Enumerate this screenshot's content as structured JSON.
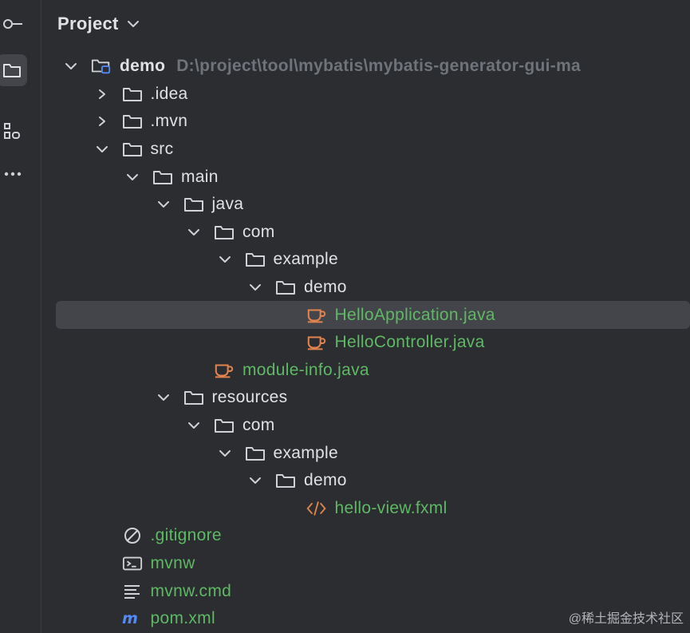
{
  "header": {
    "title": "Project"
  },
  "tree": [
    {
      "level": 0,
      "expanded": true,
      "type": "module",
      "label": "demo",
      "hint": "D:\\project\\tool\\mybatis\\mybatis-generator-gui-ma",
      "color": "plain",
      "bold": true
    },
    {
      "level": 1,
      "expanded": false,
      "type": "folder",
      "label": ".idea",
      "color": "plain"
    },
    {
      "level": 1,
      "expanded": false,
      "type": "folder",
      "label": ".mvn",
      "color": "plain"
    },
    {
      "level": 1,
      "expanded": true,
      "type": "folder",
      "label": "src",
      "color": "plain"
    },
    {
      "level": 2,
      "expanded": true,
      "type": "folder",
      "label": "main",
      "color": "plain"
    },
    {
      "level": 3,
      "expanded": true,
      "type": "folder",
      "label": "java",
      "color": "plain"
    },
    {
      "level": 4,
      "expanded": true,
      "type": "folder",
      "label": "com",
      "color": "plain"
    },
    {
      "level": 5,
      "expanded": true,
      "type": "folder",
      "label": "example",
      "color": "plain"
    },
    {
      "level": 6,
      "expanded": true,
      "type": "folder",
      "label": "demo",
      "color": "plain"
    },
    {
      "level": 7,
      "type": "java",
      "label": "HelloApplication.java",
      "color": "green",
      "selected": true
    },
    {
      "level": 7,
      "type": "java",
      "label": "HelloController.java",
      "color": "green"
    },
    {
      "level": 4,
      "type": "java",
      "label": "module-info.java",
      "color": "green"
    },
    {
      "level": 3,
      "expanded": true,
      "type": "folder",
      "label": "resources",
      "color": "plain"
    },
    {
      "level": 4,
      "expanded": true,
      "type": "folder",
      "label": "com",
      "color": "plain"
    },
    {
      "level": 5,
      "expanded": true,
      "type": "folder",
      "label": "example",
      "color": "plain"
    },
    {
      "level": 6,
      "expanded": true,
      "type": "folder",
      "label": "demo",
      "color": "plain"
    },
    {
      "level": 7,
      "type": "fxml",
      "label": "hello-view.fxml",
      "color": "green"
    },
    {
      "level": 1,
      "type": "gitignore",
      "label": ".gitignore",
      "color": "green"
    },
    {
      "level": 1,
      "type": "terminal",
      "label": "mvnw",
      "color": "green"
    },
    {
      "level": 1,
      "type": "text",
      "label": "mvnw.cmd",
      "color": "green"
    },
    {
      "level": 1,
      "type": "maven",
      "label": "pom.xml",
      "color": "green"
    }
  ],
  "watermark": "@稀土掘金技术社区",
  "colors": {
    "background": "#2b2d30",
    "selection": "#43454a",
    "text": "#dfe1e5",
    "vcs_added": "#5fb865",
    "java_icon": "#e0834e",
    "muted": "#6f737a"
  }
}
